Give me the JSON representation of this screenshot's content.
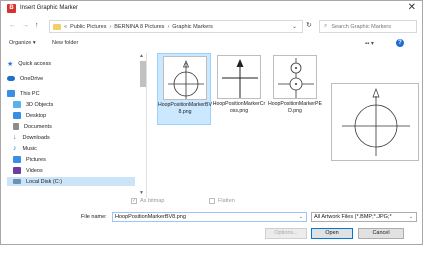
{
  "window": {
    "title": "Insert Graphic Marker",
    "app_icon": "B",
    "close_glyph": "✕"
  },
  "nav": {
    "back": "←",
    "forward": "→",
    "up": "↑",
    "breadcrumb": [
      "«",
      "Public Pictures",
      "›",
      "BERNINA 8 Pictures",
      "›",
      "Graphic Markers"
    ],
    "dropdown": "⌄",
    "refresh": "↻",
    "search_placeholder": "Search Graphic Markers"
  },
  "toolbar": {
    "organize": "Organize ▾",
    "new_folder": "New folder",
    "view": "▪▪ ▾",
    "help": "?"
  },
  "sidebar": {
    "items": [
      {
        "label": "Quick access",
        "icon": "star-icon",
        "color": "#2b78d2"
      },
      {
        "label": "OneDrive",
        "icon": "cloud-icon",
        "color": "#1f6fc5"
      },
      {
        "label": "This PC",
        "icon": "computer-icon",
        "color": "#3a8ee6"
      },
      {
        "label": "3D Objects",
        "icon": "cube-icon",
        "color": "#5bb0f0"
      },
      {
        "label": "Desktop",
        "icon": "desktop-icon",
        "color": "#3a8ee6"
      },
      {
        "label": "Documents",
        "icon": "document-icon",
        "color": "#8c8c8c"
      },
      {
        "label": "Downloads",
        "icon": "download-icon",
        "color": "#2b78d2"
      },
      {
        "label": "Music",
        "icon": "music-icon",
        "color": "#2b78d2"
      },
      {
        "label": "Pictures",
        "icon": "picture-icon",
        "color": "#3a8ee6"
      },
      {
        "label": "Videos",
        "icon": "video-icon",
        "color": "#6b3fa0"
      },
      {
        "label": "Local Disk (C:)",
        "icon": "disk-icon",
        "color": "#6f8fb3"
      }
    ],
    "scroll_up": "▲",
    "scroll_down": "▼"
  },
  "files": [
    {
      "name": "HoopPositionMarkerBV8.png",
      "selected": true
    },
    {
      "name": "HoopPositionMarkerCross.png",
      "selected": false
    },
    {
      "name": "HoopPositionMarkerPED.png",
      "selected": false
    }
  ],
  "options": {
    "as_bitmap": "As bitmap",
    "flatten": "Flatten",
    "check_glyph": "✓"
  },
  "file_name": {
    "label": "File name:",
    "value": "HoopPositionMarkerBV8.png",
    "dropdown": "⌄"
  },
  "filter": {
    "value": "All Artwork Files (*.BMP;*.JPG;*",
    "dropdown": "⌄"
  },
  "buttons": {
    "options": "Options...",
    "open": "Open",
    "cancel": "Cancel"
  }
}
